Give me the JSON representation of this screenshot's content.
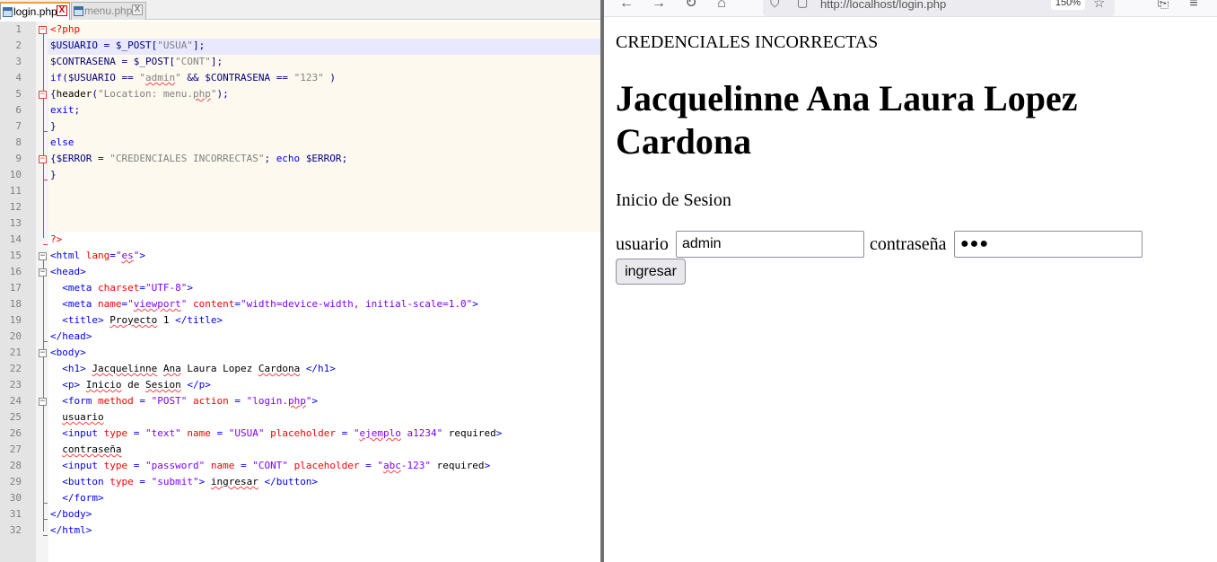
{
  "editor": {
    "tabs": [
      {
        "label": "login.php",
        "close": "X"
      },
      {
        "label": "menu.php",
        "close": "X"
      }
    ],
    "lines": [
      {
        "n": "1",
        "code": [
          [
            "php",
            "<?php"
          ]
        ]
      },
      {
        "n": "2",
        "code": [
          [
            "var",
            "$USUARIO"
          ],
          [
            "op",
            " = "
          ],
          [
            "var",
            "$_POST"
          ],
          [
            "op",
            "["
          ],
          [
            "str",
            "\"USUA\""
          ],
          [
            "op",
            "];"
          ]
        ]
      },
      {
        "n": "3",
        "code": [
          [
            "var",
            "$CONTRASENA"
          ],
          [
            "op",
            " = "
          ],
          [
            "var",
            "$_POST"
          ],
          [
            "op",
            "["
          ],
          [
            "str",
            "\"CONT\""
          ],
          [
            "op",
            "];"
          ]
        ]
      },
      {
        "n": "4",
        "code": [
          [
            "kw",
            "if"
          ],
          [
            "op",
            "("
          ],
          [
            "var",
            "$USUARIO"
          ],
          [
            "op",
            " == "
          ],
          [
            "str",
            "\""
          ],
          [
            "strs",
            "admin"
          ],
          [
            "str",
            "\""
          ],
          [
            "op",
            " && "
          ],
          [
            "var",
            "$CONTRASENA"
          ],
          [
            "op",
            " == "
          ],
          [
            "str",
            "\"123\""
          ],
          [
            "op",
            " )"
          ]
        ]
      },
      {
        "n": "5",
        "code": [
          [
            "op",
            "{"
          ],
          [
            "txt",
            "header"
          ],
          [
            "op",
            "("
          ],
          [
            "str",
            "\"Location: menu."
          ],
          [
            "strs",
            "php"
          ],
          [
            "str",
            "\""
          ],
          [
            "op",
            ");"
          ]
        ]
      },
      {
        "n": "6",
        "code": [
          [
            "kw",
            "exit"
          ],
          [
            "op",
            ";"
          ]
        ]
      },
      {
        "n": "7",
        "code": [
          [
            "op",
            "}"
          ]
        ]
      },
      {
        "n": "8",
        "code": [
          [
            "kw",
            "else"
          ]
        ]
      },
      {
        "n": "9",
        "code": [
          [
            "op",
            "{"
          ],
          [
            "var",
            "$ERROR"
          ],
          [
            "op",
            " = "
          ],
          [
            "str",
            "\"CREDENCIALES INCORRECTAS\""
          ],
          [
            "op",
            "; "
          ],
          [
            "kw",
            "echo"
          ],
          [
            "op",
            " "
          ],
          [
            "var",
            "$ERROR"
          ],
          [
            "op",
            ";"
          ]
        ]
      },
      {
        "n": "10",
        "code": [
          [
            "op",
            "}"
          ]
        ]
      },
      {
        "n": "11",
        "code": []
      },
      {
        "n": "12",
        "code": []
      },
      {
        "n": "13",
        "code": []
      },
      {
        "n": "14",
        "code": [
          [
            "php",
            "?>"
          ]
        ]
      },
      {
        "n": "15",
        "code": [
          [
            "tag",
            "<html "
          ],
          [
            "attr",
            "lang"
          ],
          [
            "tag",
            "="
          ],
          [
            "val",
            "\""
          ],
          [
            "vals",
            "es"
          ],
          [
            "val",
            "\""
          ],
          [
            "tag",
            ">"
          ]
        ]
      },
      {
        "n": "16",
        "code": [
          [
            "tag",
            "<head>"
          ]
        ]
      },
      {
        "n": "17",
        "code": [
          [
            "txt",
            "  "
          ],
          [
            "tag",
            "<meta "
          ],
          [
            "attr",
            "charset"
          ],
          [
            "tag",
            "="
          ],
          [
            "val",
            "\"UTF-8\""
          ],
          [
            "tag",
            ">"
          ]
        ]
      },
      {
        "n": "18",
        "code": [
          [
            "txt",
            "  "
          ],
          [
            "tag",
            "<meta "
          ],
          [
            "attr",
            "name"
          ],
          [
            "tag",
            "="
          ],
          [
            "val",
            "\""
          ],
          [
            "vals",
            "viewport"
          ],
          [
            "val",
            "\""
          ],
          [
            "tag",
            " "
          ],
          [
            "attr",
            "content"
          ],
          [
            "tag",
            "="
          ],
          [
            "val",
            "\"width=device-width, initial-scale=1.0\""
          ],
          [
            "tag",
            ">"
          ]
        ]
      },
      {
        "n": "19",
        "code": [
          [
            "txt",
            "  "
          ],
          [
            "tag",
            "<title>"
          ],
          [
            "txt",
            " "
          ],
          [
            "txts",
            "Proyecto"
          ],
          [
            "txt",
            " 1 "
          ],
          [
            "tag",
            "</title>"
          ]
        ]
      },
      {
        "n": "20",
        "code": [
          [
            "tag",
            "</head>"
          ]
        ]
      },
      {
        "n": "21",
        "code": [
          [
            "tag",
            "<body>"
          ]
        ]
      },
      {
        "n": "22",
        "code": [
          [
            "txt",
            "  "
          ],
          [
            "tag",
            "<h1>"
          ],
          [
            "txt",
            " "
          ],
          [
            "txts",
            "Jacquelinne"
          ],
          [
            "txt",
            " "
          ],
          [
            "txts",
            "Ana"
          ],
          [
            "txt",
            " Laura Lopez "
          ],
          [
            "txts",
            "Cardona"
          ],
          [
            "txt",
            " "
          ],
          [
            "tag",
            "</h1>"
          ]
        ]
      },
      {
        "n": "23",
        "code": [
          [
            "txt",
            "  "
          ],
          [
            "tag",
            "<p>"
          ],
          [
            "txt",
            " "
          ],
          [
            "txts",
            "Inicio"
          ],
          [
            "txt",
            " de "
          ],
          [
            "txts",
            "Sesion"
          ],
          [
            "txt",
            " "
          ],
          [
            "tag",
            "</p>"
          ]
        ]
      },
      {
        "n": "24",
        "code": [
          [
            "txt",
            "  "
          ],
          [
            "tag",
            "<form "
          ],
          [
            "attr",
            "method"
          ],
          [
            "tag",
            " = "
          ],
          [
            "val",
            "\"POST\""
          ],
          [
            "tag",
            " "
          ],
          [
            "attr",
            "action"
          ],
          [
            "tag",
            " = "
          ],
          [
            "val",
            "\"login."
          ],
          [
            "vals",
            "php"
          ],
          [
            "val",
            "\""
          ],
          [
            "tag",
            ">"
          ]
        ]
      },
      {
        "n": "25",
        "code": [
          [
            "txt",
            "  "
          ],
          [
            "txts",
            "usuario"
          ]
        ]
      },
      {
        "n": "26",
        "code": [
          [
            "txt",
            "  "
          ],
          [
            "tag",
            "<input "
          ],
          [
            "attr",
            "type"
          ],
          [
            "tag",
            " = "
          ],
          [
            "val",
            "\"text\""
          ],
          [
            "tag",
            " "
          ],
          [
            "attr",
            "name"
          ],
          [
            "tag",
            " = "
          ],
          [
            "val",
            "\"USUA\""
          ],
          [
            "tag",
            " "
          ],
          [
            "attr",
            "placeholder"
          ],
          [
            "tag",
            " = "
          ],
          [
            "val",
            "\""
          ],
          [
            "vals",
            "ejemplo"
          ],
          [
            "val",
            " a1234\""
          ],
          [
            "txt",
            " required"
          ],
          [
            "tag",
            ">"
          ]
        ]
      },
      {
        "n": "27",
        "code": [
          [
            "txt",
            "  "
          ],
          [
            "txts",
            "contraseña"
          ]
        ]
      },
      {
        "n": "28",
        "code": [
          [
            "txt",
            "  "
          ],
          [
            "tag",
            "<input "
          ],
          [
            "attr",
            "type"
          ],
          [
            "tag",
            " = "
          ],
          [
            "val",
            "\"password\""
          ],
          [
            "tag",
            " "
          ],
          [
            "attr",
            "name"
          ],
          [
            "tag",
            " = "
          ],
          [
            "val",
            "\"CONT\""
          ],
          [
            "tag",
            " "
          ],
          [
            "attr",
            "placeholder"
          ],
          [
            "tag",
            " = "
          ],
          [
            "val",
            "\""
          ],
          [
            "vals",
            "abc"
          ],
          [
            "val",
            "-123\""
          ],
          [
            "txt",
            " required"
          ],
          [
            "tag",
            ">"
          ]
        ]
      },
      {
        "n": "29",
        "code": [
          [
            "txt",
            "  "
          ],
          [
            "tag",
            "<button "
          ],
          [
            "attr",
            "type"
          ],
          [
            "tag",
            " = "
          ],
          [
            "val",
            "\"submit\""
          ],
          [
            "tag",
            ">"
          ],
          [
            "txt",
            " "
          ],
          [
            "txts",
            "ingresar"
          ],
          [
            "txt",
            " "
          ],
          [
            "tag",
            "</button>"
          ]
        ]
      },
      {
        "n": "30",
        "code": [
          [
            "txt",
            "  "
          ],
          [
            "tag",
            "</form>"
          ]
        ]
      },
      {
        "n": "31",
        "code": [
          [
            "tag",
            "</body>"
          ]
        ]
      },
      {
        "n": "32",
        "code": [
          [
            "tag",
            "</html>"
          ]
        ]
      }
    ]
  },
  "browser": {
    "url": "http://localhost/login.php",
    "zoom": "150%",
    "icons": [
      "back-arrow-icon",
      "forward-arrow-icon",
      "reload-icon",
      "home-icon",
      "shield-icon",
      "lock-icon",
      "star-icon",
      "extensions-icon",
      "menu-icon"
    ]
  },
  "page": {
    "error": "CREDENCIALES INCORRECTAS",
    "heading": "Jacquelinne Ana Laura Lopez Cardona",
    "subtitle": "Inicio de Sesion",
    "usuario_label": "usuario",
    "usuario_value": "admin",
    "contrasena_label": "contraseña",
    "contrasena_value": "●●●",
    "submit_label": "ingresar"
  }
}
